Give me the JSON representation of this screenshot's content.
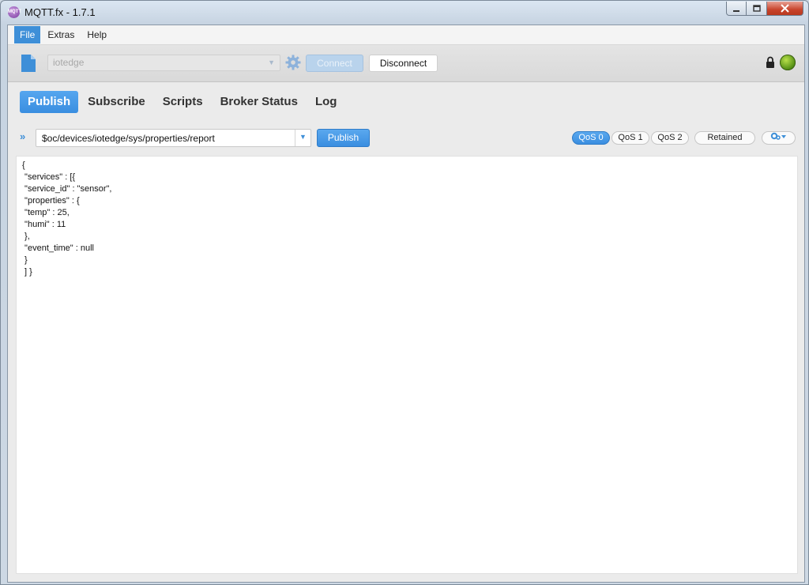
{
  "window": {
    "title": "MQTT.fx - 1.7.1",
    "icon_text": "MQTT"
  },
  "menu": {
    "items": [
      {
        "label": "File",
        "active": true
      },
      {
        "label": "Extras",
        "active": false
      },
      {
        "label": "Help",
        "active": false
      }
    ]
  },
  "toolbar": {
    "profile_value": "iotedge",
    "connect_label": "Connect",
    "disconnect_label": "Disconnect",
    "status_color": "#6aa81e"
  },
  "tabs": [
    "Publish",
    "Subscribe",
    "Scripts",
    "Broker Status",
    "Log"
  ],
  "active_tab": "Publish",
  "publish": {
    "topic": "$oc/devices/iotedge/sys/properties/report",
    "publish_label": "Publish",
    "qos": [
      {
        "label": "QoS 0",
        "selected": true
      },
      {
        "label": "QoS 1",
        "selected": false
      },
      {
        "label": "QoS 2",
        "selected": false
      }
    ],
    "retained_label": "Retained",
    "payload": "{\n \"services\" : [{\n \"service_id\" : \"sensor\",\n \"properties\" : {\n \"temp\" : 25,\n \"humi\" : 11\n },\n \"event_time\" : null\n }\n ] }"
  },
  "colors": {
    "accent": "#3e8fd8",
    "close": "#c8442c"
  }
}
